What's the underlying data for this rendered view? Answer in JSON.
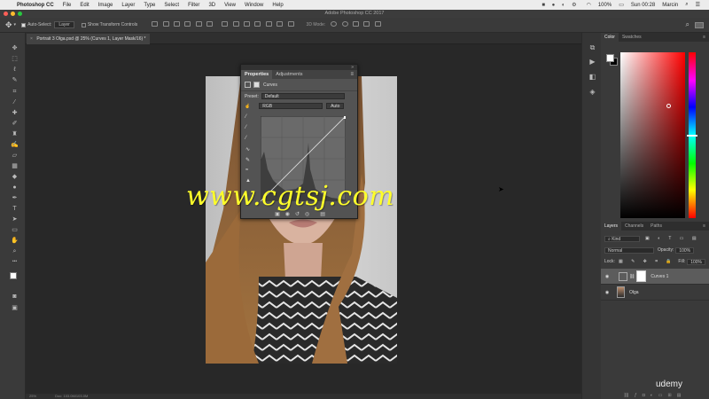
{
  "menubar": {
    "app_name": "Photoshop CC",
    "items": [
      "File",
      "Edit",
      "Image",
      "Layer",
      "Type",
      "Select",
      "Filter",
      "3D",
      "View",
      "Window",
      "Help"
    ],
    "battery": "100%",
    "clock": "Sun 00:28",
    "user": "Marcin"
  },
  "window": {
    "title": "Adobe Photoshop CC 2017"
  },
  "options": {
    "auto_select_label": "Auto-Select:",
    "auto_select_value": "Layer",
    "transform_label": "Show Transform Controls",
    "mode_3d": "3D Mode:"
  },
  "document": {
    "tab_title": "Portrait 3 Olga.psd @ 25% (Curves 1, Layer Mask/16) *"
  },
  "properties": {
    "tabs": [
      "Properties",
      "Adjustments"
    ],
    "active_tab": "Properties",
    "adjustment_name": "Curves",
    "preset_label": "Preset:",
    "preset_value": "Default",
    "channel_value": "RGB",
    "auto_button": "Auto"
  },
  "color_panel": {
    "tabs": [
      "Color",
      "Swatches"
    ],
    "foreground": "#ffffff",
    "background": "#000000"
  },
  "layers_panel": {
    "tabs": [
      "Layers",
      "Channels",
      "Paths"
    ],
    "filter_value": "Kind",
    "blend_mode": "Normal",
    "opacity_label": "Opacity:",
    "opacity_value": "100%",
    "lock_label": "Lock:",
    "fill_label": "Fill:",
    "fill_value": "100%",
    "layers": [
      {
        "name": "Curves 1",
        "type": "adjustment",
        "selected": true
      },
      {
        "name": "Olga",
        "type": "pixel",
        "selected": false
      }
    ]
  },
  "watermark": "www.cgtsj.com",
  "brand": "udemy",
  "status": {
    "zoom": "25%",
    "doc_info": "Doc: 103.0M/103.0M"
  },
  "colors": {
    "accent_red": "#ff0000",
    "watermark_yellow": "#ffff2a",
    "panel_bg": "#3a3a3a"
  }
}
